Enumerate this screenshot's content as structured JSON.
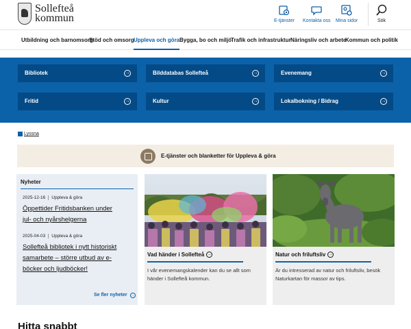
{
  "header": {
    "logo_line1": "Sollefteå",
    "logo_line2": "kommun",
    "icons": [
      {
        "label": "E-tjänster",
        "icon": "gear-icon"
      },
      {
        "label": "Kontakta oss",
        "icon": "chat-icon"
      },
      {
        "label": "Mina sidor",
        "icon": "profile-gear-icon"
      }
    ],
    "search_label": "Sök"
  },
  "mainnav": {
    "items": [
      "Utbildning och barnomsorg",
      "Stöd och omsorg",
      "Uppleva och göra",
      "Bygga, bo och miljö",
      "Trafik och infrastruktur",
      "Näringsliv och arbete",
      "Kommun och politik"
    ],
    "active": "Uppleva och göra"
  },
  "tiles": [
    "Bibliotek",
    "Bilddatabas Sollefteå",
    "Evenemang",
    "Fritid",
    "Kultur",
    "Lokalbokning / Bidrag"
  ],
  "lyssna": "Lyssna",
  "eservices": "E-tjänster och blanketter för Uppleva & göra",
  "news": {
    "title": "Nyheter",
    "items": [
      {
        "date": "2025-12-16",
        "category": "Uppleva & göra",
        "line1": "Öppettider Fritidsbanken under",
        "line2": "jul- och nyårshelgerna"
      },
      {
        "date": "2025-04-03",
        "category": "Uppleva & göra",
        "line1": "Sollefteå bibliotek i nytt historiskt",
        "line2": "samarbete – större utbud av e-",
        "line3": "böcker och ljudböcker!"
      }
    ],
    "more": "Se fler nyheter"
  },
  "cards": [
    {
      "title": "Vad händer i Sollefteå",
      "line1": "I vår evenemangskalender kan du se allt som",
      "line2": "händer i Sollefteå kommun."
    },
    {
      "title": "Natur och friluftsliv",
      "line1": "Är du intresserad av natur och friluftsliv, besök",
      "line2": "Naturkartan för massor av tips."
    }
  ],
  "hitta": "Hitta snabbt",
  "colors": {
    "brand": "#0b62a9",
    "tile": "#034a86",
    "news_bg": "#e9eef4",
    "eservice_bg": "#f3ede4"
  }
}
